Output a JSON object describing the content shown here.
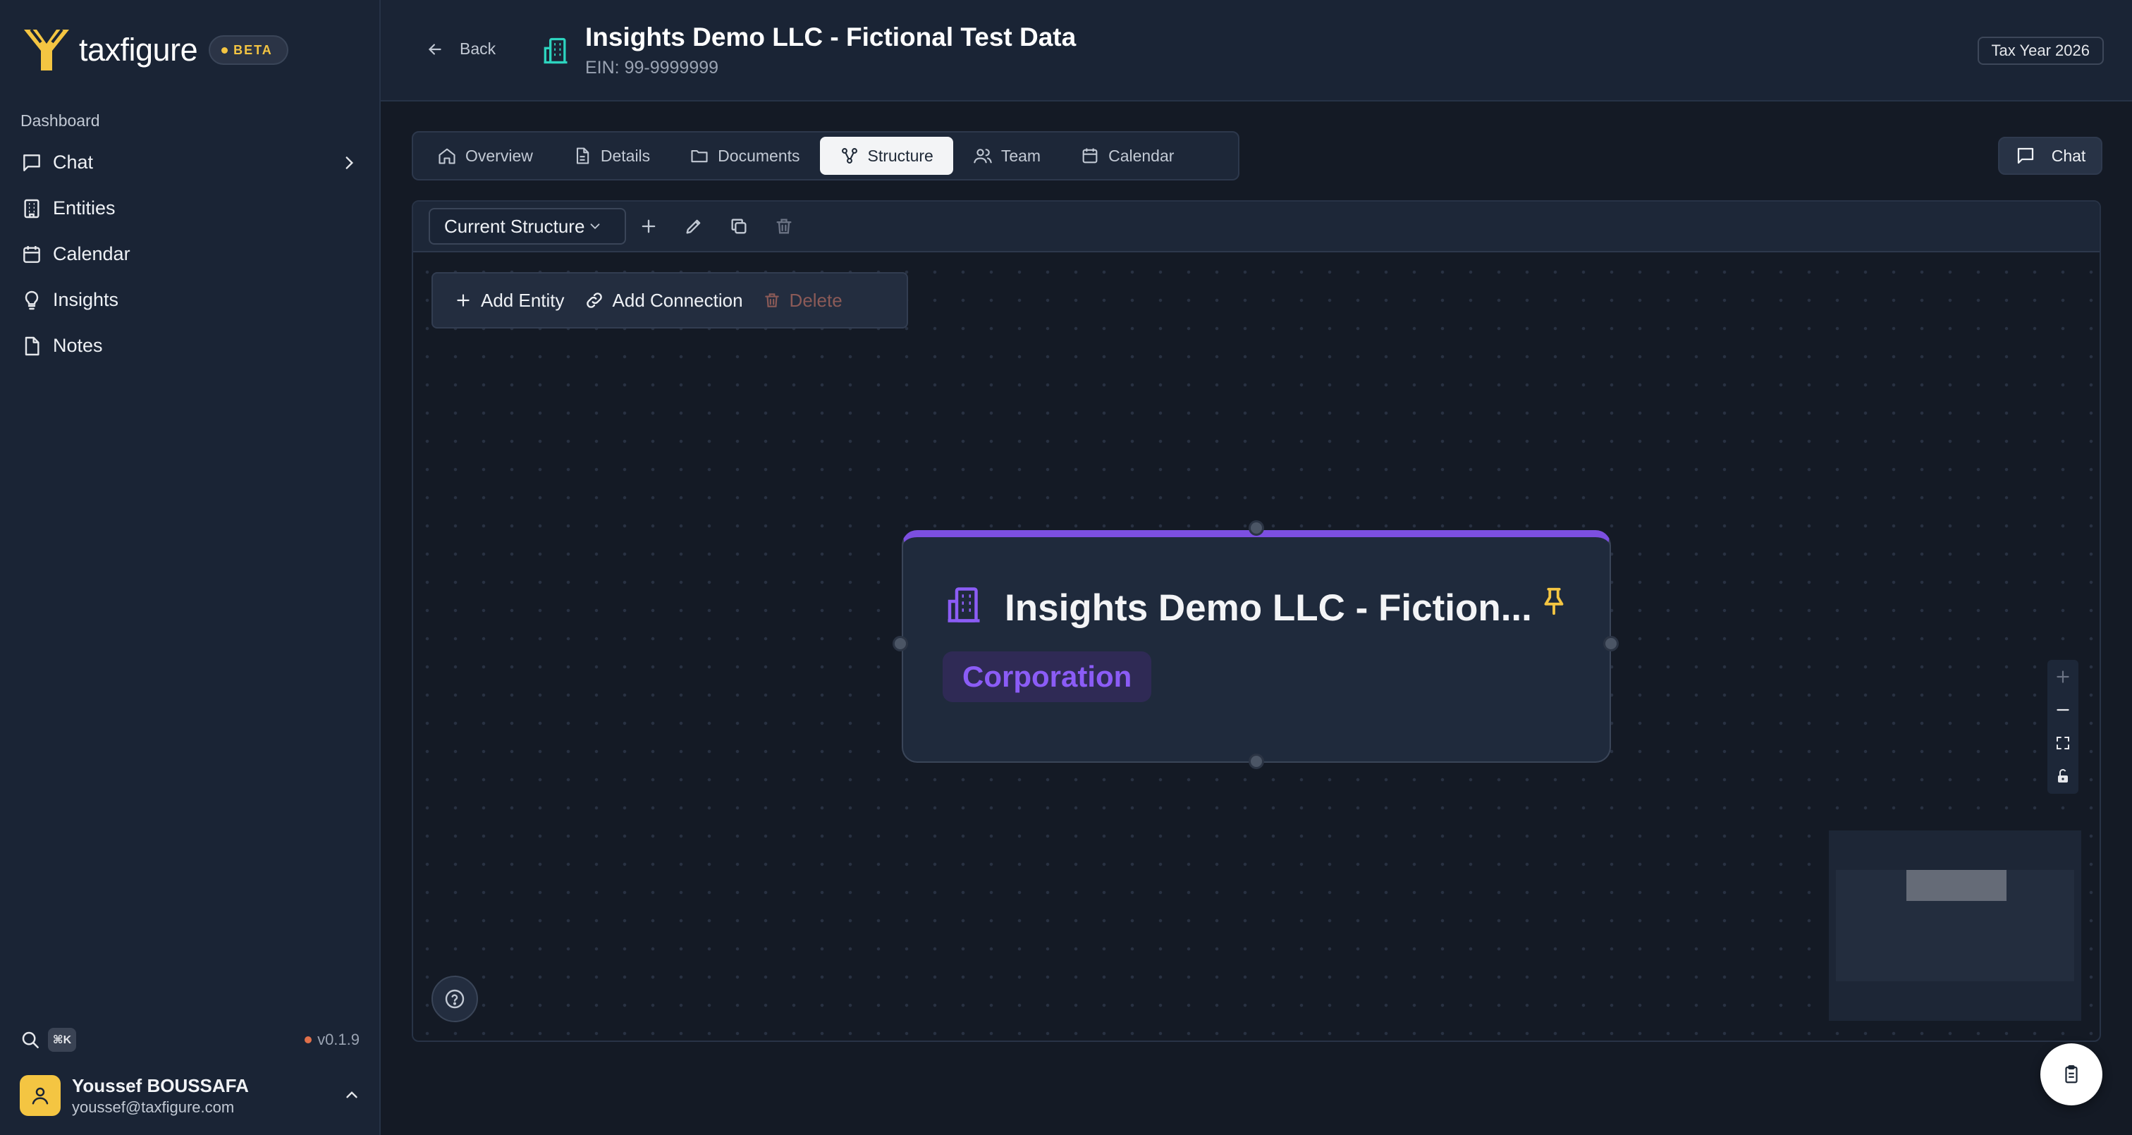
{
  "brand": {
    "name": "taxfigure",
    "badge": "BETA"
  },
  "sidebar": {
    "section_label": "Dashboard",
    "items": [
      {
        "label": "Chat",
        "icon": "message-square-icon",
        "has_submenu": true
      },
      {
        "label": "Entities",
        "icon": "building-icon"
      },
      {
        "label": "Calendar",
        "icon": "calendar-icon"
      },
      {
        "label": "Insights",
        "icon": "lightbulb-icon"
      },
      {
        "label": "Notes",
        "icon": "file-icon"
      }
    ],
    "shortcut": "⌘K",
    "version": "v0.1.9",
    "user": {
      "name": "Youssef BOUSSAFA",
      "email": "youssef@taxfigure.com"
    }
  },
  "header": {
    "back_label": "Back",
    "title": "Insights Demo LLC - Fictional Test Data",
    "ein": "EIN: 99-9999999",
    "tax_year": "Tax Year 2026"
  },
  "tabs": [
    {
      "label": "Overview",
      "icon": "home-icon",
      "active": false
    },
    {
      "label": "Details",
      "icon": "file-text-icon",
      "active": false
    },
    {
      "label": "Documents",
      "icon": "folder-icon",
      "active": false
    },
    {
      "label": "Structure",
      "icon": "network-icon",
      "active": true
    },
    {
      "label": "Team",
      "icon": "users-icon",
      "active": false
    },
    {
      "label": "Calendar",
      "icon": "calendar-icon",
      "active": false
    }
  ],
  "chat_button": {
    "label": "Chat"
  },
  "toolbar": {
    "structure_select": "Current Structure"
  },
  "actions": {
    "add_entity": "Add Entity",
    "add_connection": "Add Connection",
    "delete": "Delete"
  },
  "node": {
    "title": "Insights Demo LLC - Fiction...",
    "type": "Corporation"
  },
  "colors": {
    "accent_purple": "#7c4fe0",
    "brand_yellow": "#f4c542",
    "entity_teal": "#2dd4bf",
    "sidebar_bg": "#1a2435",
    "canvas_bg": "#141a25"
  }
}
